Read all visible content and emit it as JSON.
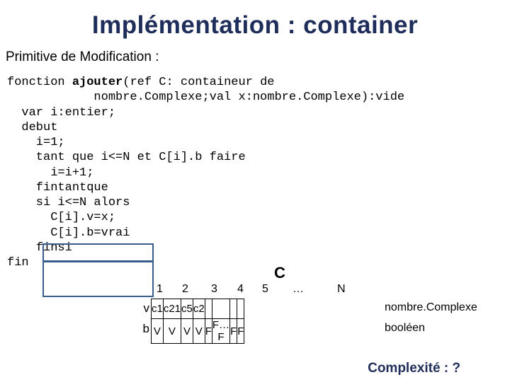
{
  "title": "Implémentation : container",
  "subtitle": "Primitive de Modification :",
  "code": {
    "l1a": "fonction ",
    "l1b": "ajouter",
    "l1c": "(ref C: containeur de",
    "l2": "            nombre.Complexe;val x:nombre.Complexe):vide",
    "l3": "  var i:entier;",
    "l4": "  debut",
    "l5": "    i=1;",
    "l6": "    tant que i<=N et C[i].b faire",
    "l7": "      i=i+1;",
    "l8": "    fintantque",
    "l9": "    si i<=N alors",
    "l10": "      C[i].v=x;",
    "l11": "      C[i].b=vrai",
    "l12": "    finsi",
    "l13": "fin"
  },
  "array_label": "C",
  "headers": {
    "h1": "1",
    "h2": "2",
    "h3": "3",
    "h4": "4",
    "h5": "5",
    "hdots": "…",
    "hN": "N"
  },
  "rowlabels": {
    "v": "v",
    "b": "b"
  },
  "row_v": {
    "c1": "c1",
    "c2": "c21",
    "c3": "c5",
    "c4": "c2",
    "c5": "",
    "c6": "",
    "c7": "",
    "c8": ""
  },
  "row_b": {
    "c1": "V",
    "c2": "V",
    "c3": "V",
    "c4": "V",
    "c5": "F",
    "c6": "F…F",
    "c7": "F",
    "c8": "F"
  },
  "rightlabels": {
    "v": "nombre.Complexe",
    "b": "booléen"
  },
  "complexity": "Complexité : ?"
}
